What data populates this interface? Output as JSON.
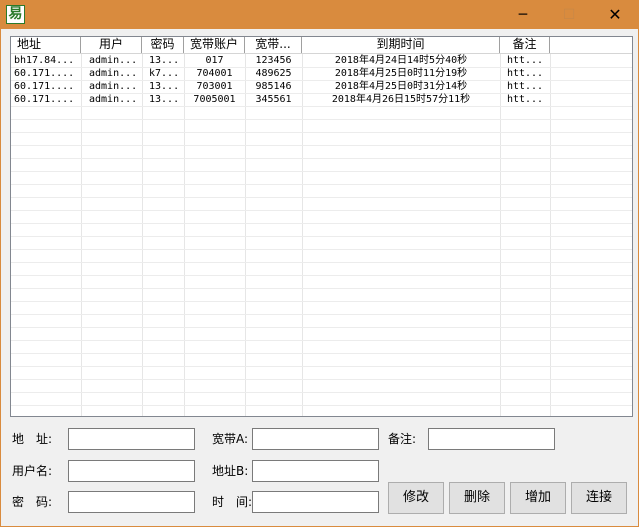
{
  "window": {
    "app_icon_glyph": "易",
    "minimize_glyph": "─",
    "maximize_glyph": "☐",
    "close_glyph": "✕"
  },
  "table": {
    "columns": [
      "地址",
      "用户",
      "密码",
      "宽带账户",
      "宽带...",
      "到期时间",
      "备注"
    ],
    "rows": [
      [
        "bh17.84...",
        "admin...",
        "13...",
        "017",
        "123456",
        "2018年4月24日14时5分40秒",
        "htt..."
      ],
      [
        "60.171....",
        "admin...",
        "k7...",
        "704001",
        "489625",
        "2018年4月25日0时11分19秒",
        "htt..."
      ],
      [
        "60.171....",
        "admin...",
        "13...",
        "703001",
        "985146",
        "2018年4月25日0时31分14秒",
        "htt..."
      ],
      [
        "60.171....",
        "admin...",
        "13...",
        "7005001",
        "345561",
        "2018年4月26日15时57分11秒",
        "htt..."
      ]
    ]
  },
  "form": {
    "address_label": "地　址:",
    "username_label": "用户名:",
    "password_label": "密　码:",
    "broadband_a_label": "宽带A:",
    "address_b_label": "地址B:",
    "time_label": "时　间:",
    "remark_label": "备注:",
    "address_value": "",
    "username_value": "",
    "password_value": "",
    "broadband_a_value": "",
    "address_b_value": "",
    "time_value": "",
    "remark_value": ""
  },
  "buttons": {
    "modify": "修改",
    "delete": "删除",
    "add": "增加",
    "connect": "连接"
  }
}
